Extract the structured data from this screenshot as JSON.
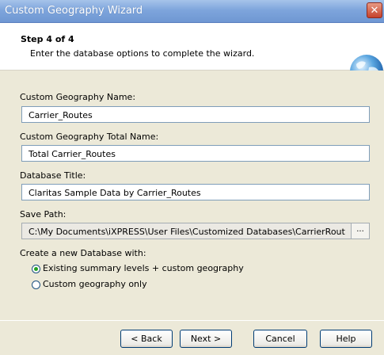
{
  "window": {
    "title": "Custom Geography Wizard",
    "close_glyph": "✕"
  },
  "header": {
    "step": "Step 4 of 4",
    "description": "Enter the database options to complete the wizard.",
    "icon": "globe-icon"
  },
  "form": {
    "name_label": "Custom Geography Name:",
    "name_value": "Carrier_Routes",
    "total_label": "Custom Geography Total Name:",
    "total_value": "Total Carrier_Routes",
    "title_label": "Database Title:",
    "title_value": "Claritas Sample Data by Carrier_Routes",
    "path_label": "Save Path:",
    "path_value": "C:\\My Documents\\iXPRESS\\User Files\\Customized Databases\\CarrierRoutes\\Clar",
    "browse_label": "...",
    "create_label": "Create a new Database with:",
    "options": [
      {
        "label": "Existing summary levels + custom geography",
        "selected": true
      },
      {
        "label": "Custom geography only",
        "selected": false
      }
    ]
  },
  "buttons": {
    "back": "< Back",
    "next": "Next >",
    "cancel": "Cancel",
    "help": "Help"
  },
  "colors": {
    "titlebar": "#7ea5dc",
    "dialog_bg": "#ece9d8",
    "input_border": "#7f9db9"
  }
}
